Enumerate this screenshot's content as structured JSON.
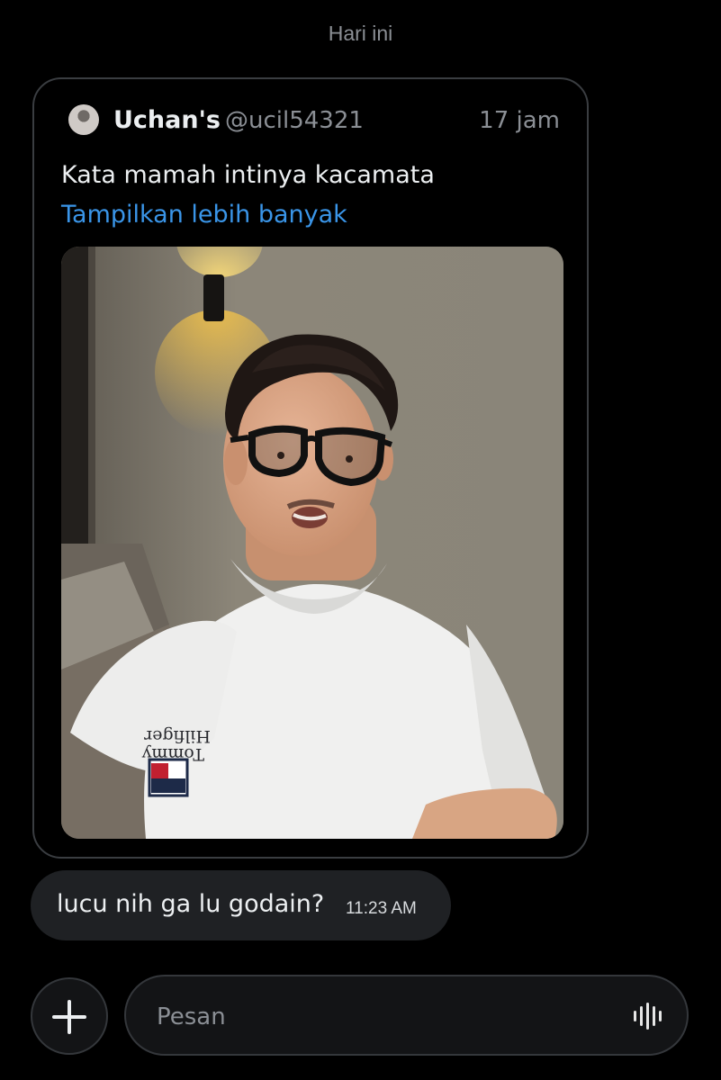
{
  "header": {
    "date_separator": "Hari ini"
  },
  "tweet": {
    "author_name": "Uchan's",
    "author_handle": "@ucil54321",
    "time_ago": "17 jam",
    "text": "Kata mamah intinya kacamata",
    "show_more_label": "Tampilkan lebih banyak",
    "photo_logo_text": "Tommy Hilfiger"
  },
  "message": {
    "text": "lucu nih ga lu godain?",
    "time": "11:23 AM"
  },
  "composer": {
    "placeholder": "Pesan",
    "add_icon": "plus-icon",
    "voice_icon": "voice-waveform-icon"
  },
  "colors": {
    "background": "#000000",
    "link": "#3a95e8",
    "bubble": "#1f2124",
    "muted_text": "#8b8f95"
  }
}
